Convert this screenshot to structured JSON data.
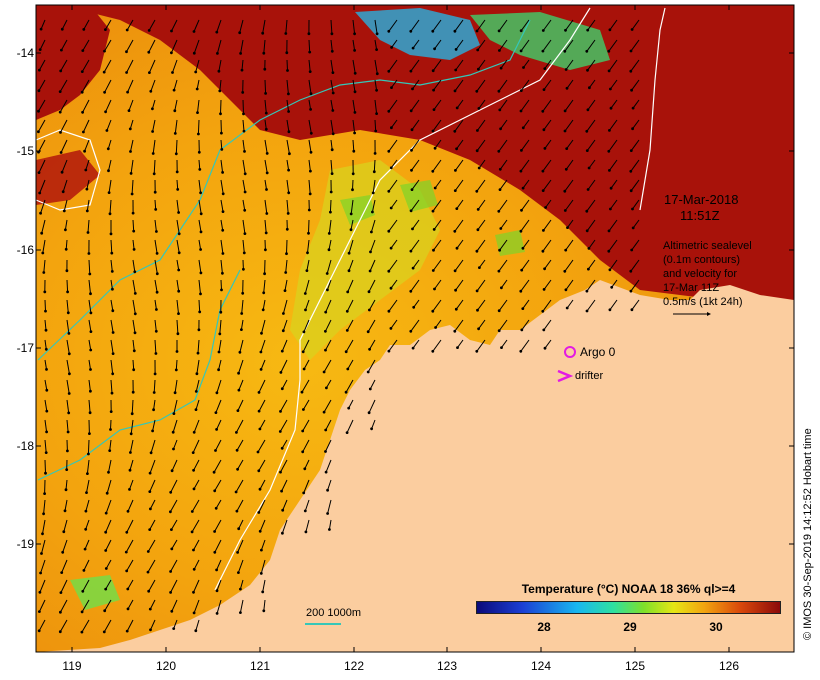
{
  "map": {
    "date_line1": "17-Mar-2018",
    "date_line2": "11:51Z",
    "legend_text": [
      "Altimetric sealevel",
      "(0.1m contours)",
      "and velocity for",
      "17-Mar 11Z",
      "0.5m/s (1kt 24h)"
    ],
    "argo_label": "Argo 0",
    "drifter_label": "drifter",
    "scale_label": "200  1000m",
    "credit": "© IMOS 30-Sep-2019 14:12:52 Hobart time",
    "colorbar": {
      "title": "Temperature (°C) NOAA 18 36% ql>=4",
      "ticks": [
        "28",
        "29",
        "30"
      ],
      "range": [
        27,
        31
      ]
    },
    "y_ticks": [
      "-14",
      "-15",
      "-16",
      "-17",
      "-18",
      "-19"
    ],
    "x_ticks": [
      "119",
      "120",
      "121",
      "122",
      "123",
      "124",
      "125",
      "126"
    ],
    "colors": {
      "land": "#fbcd9f",
      "warm_sst": "#f5a90f",
      "hot_sst": "#a50c04",
      "contour": "#ffffff",
      "isobath": "#35c7b8",
      "argo": "#e31be3",
      "drifter": "#e31be3",
      "arrow": "#000000"
    }
  }
}
